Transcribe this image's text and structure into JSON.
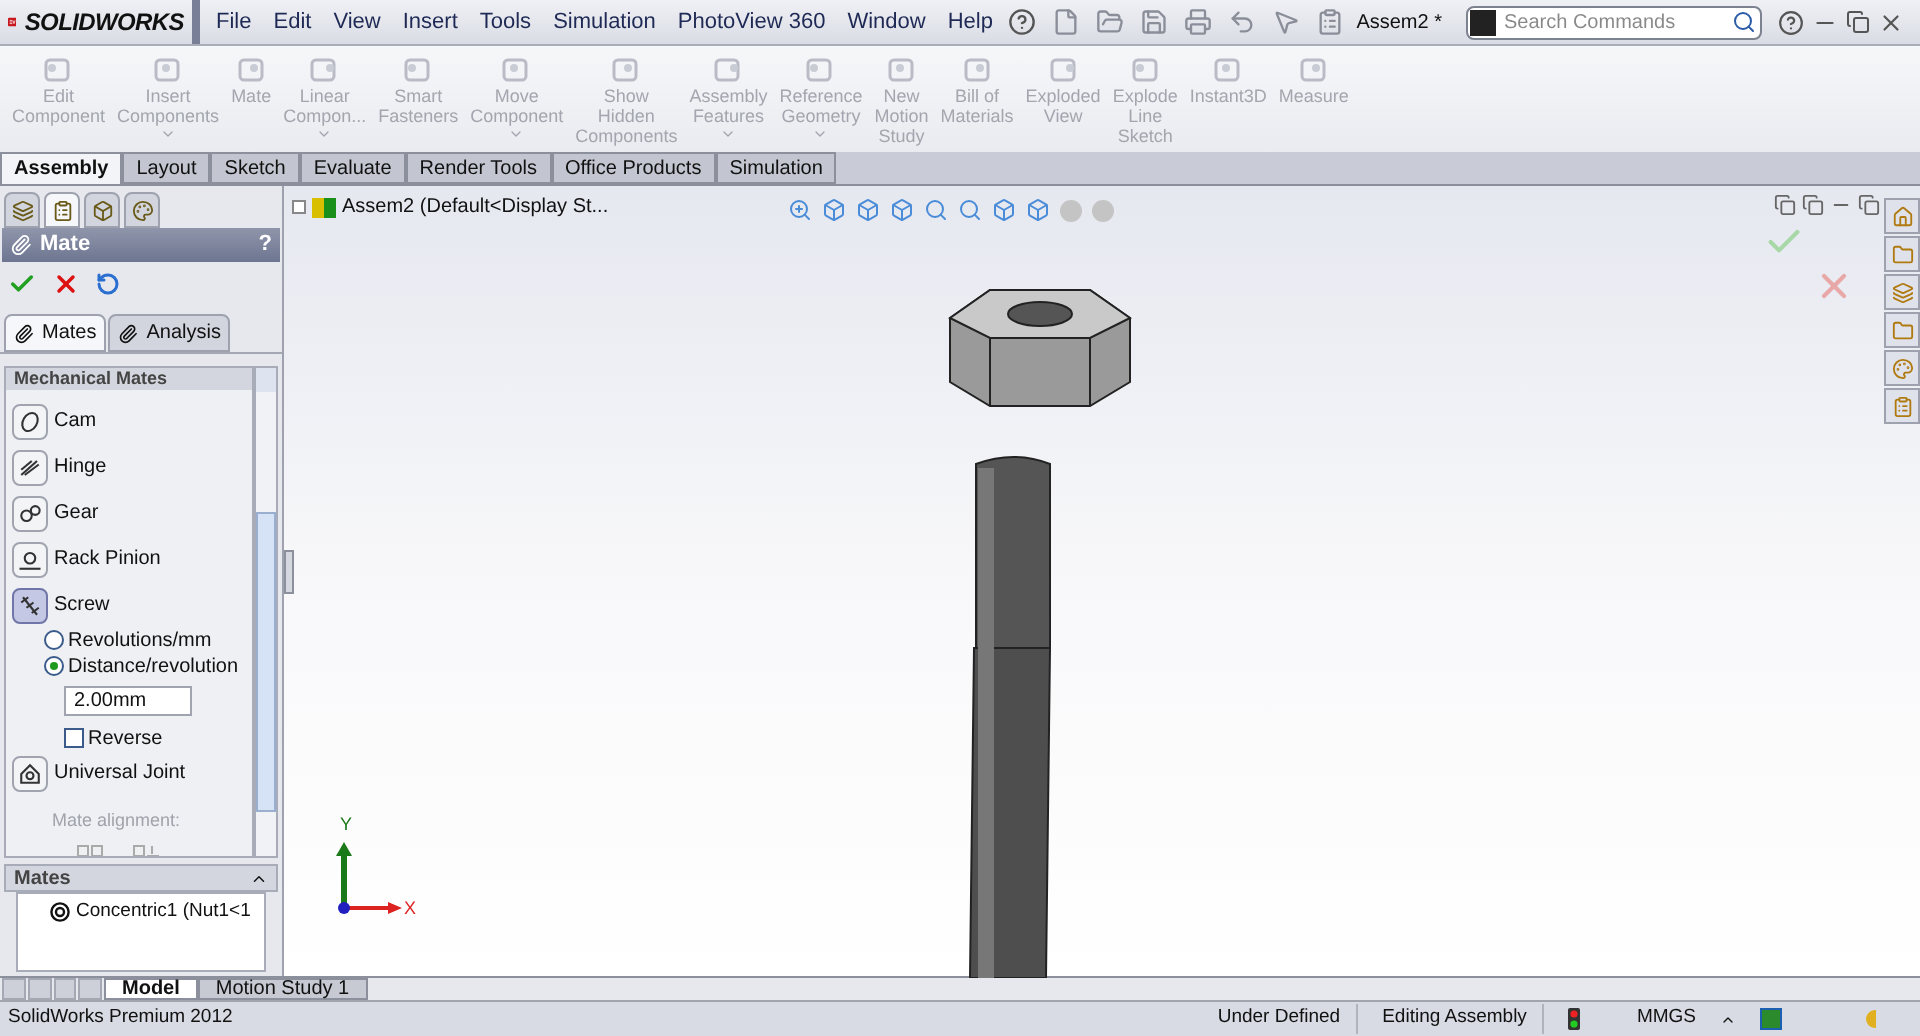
{
  "app": {
    "logo": "SOLIDWORKS",
    "menu": [
      "File",
      "Edit",
      "View",
      "Insert",
      "Tools",
      "Simulation",
      "PhotoView 360",
      "Window",
      "Help"
    ],
    "document": "Assem2 *",
    "search": {
      "placeholder": "Search Commands"
    }
  },
  "ribbon": [
    {
      "label": "Edit\nComponent",
      "disabled": true,
      "dropdown": false
    },
    {
      "label": "Insert\nComponents",
      "disabled": true,
      "dropdown": true
    },
    {
      "label": "Mate",
      "disabled": true,
      "dropdown": false
    },
    {
      "label": "Linear\nCompon...",
      "disabled": true,
      "dropdown": true
    },
    {
      "label": "Smart\nFasteners",
      "disabled": true,
      "dropdown": false
    },
    {
      "label": "Move\nComponent",
      "disabled": true,
      "dropdown": true
    },
    {
      "label": "Show\nHidden\nComponents",
      "disabled": true,
      "dropdown": false
    },
    {
      "label": "Assembly\nFeatures",
      "disabled": true,
      "dropdown": true
    },
    {
      "label": "Reference\nGeometry",
      "disabled": true,
      "dropdown": true
    },
    {
      "label": "New\nMotion\nStudy",
      "disabled": true,
      "dropdown": false
    },
    {
      "label": "Bill of\nMaterials",
      "disabled": true,
      "dropdown": false
    },
    {
      "label": "Exploded\nView",
      "disabled": true,
      "dropdown": false
    },
    {
      "label": "Explode\nLine\nSketch",
      "disabled": true,
      "dropdown": false
    },
    {
      "label": "Instant3D",
      "disabled": true,
      "dropdown": false
    },
    {
      "label": "Measure",
      "disabled": true,
      "dropdown": false
    }
  ],
  "command_tabs": [
    {
      "label": "Assembly",
      "selected": true
    },
    {
      "label": "Layout",
      "selected": false
    },
    {
      "label": "Sketch",
      "selected": false
    },
    {
      "label": "Evaluate",
      "selected": false
    },
    {
      "label": "Render Tools",
      "selected": false
    },
    {
      "label": "Office Products",
      "selected": false
    },
    {
      "label": "Simulation",
      "selected": false
    }
  ],
  "manager_tabs": [
    {
      "selected": false
    },
    {
      "selected": true
    },
    {
      "selected": false
    },
    {
      "selected": false
    }
  ],
  "property_manager": {
    "title": "Mate",
    "help": "?",
    "subtabs": [
      {
        "label": "Mates",
        "selected": true
      },
      {
        "label": "Analysis",
        "selected": false
      }
    ],
    "section": "Mechanical Mates",
    "mates": [
      {
        "label": "Cam",
        "selected": false
      },
      {
        "label": "Hinge",
        "selected": false
      },
      {
        "label": "Gear",
        "selected": false
      },
      {
        "label": "Rack Pinion",
        "selected": false
      },
      {
        "label": "Screw",
        "selected": true,
        "options": {
          "modes": [
            {
              "label": "Revolutions/mm",
              "selected": false
            },
            {
              "label": "Distance/revolution",
              "selected": true
            }
          ],
          "value": "2.00mm",
          "reverse": {
            "label": "Reverse",
            "checked": false
          }
        }
      },
      {
        "label": "Universal Joint",
        "selected": false
      }
    ],
    "alignment_label": "Mate alignment:",
    "mates_box": {
      "title": "Mates",
      "items": [
        "Concentric1 (Nut1<1"
      ]
    }
  },
  "tree": {
    "root": "Assem2  (Default<Display St..."
  },
  "triad": {
    "y": "Y",
    "x": "X"
  },
  "bottom_tabs": [
    {
      "label": "Model",
      "selected": true
    },
    {
      "label": "Motion Study 1",
      "selected": false
    }
  ],
  "status": {
    "product": "SolidWorks Premium 2012",
    "items": [
      "Under Defined",
      "Editing Assembly"
    ],
    "units": "MMGS"
  }
}
